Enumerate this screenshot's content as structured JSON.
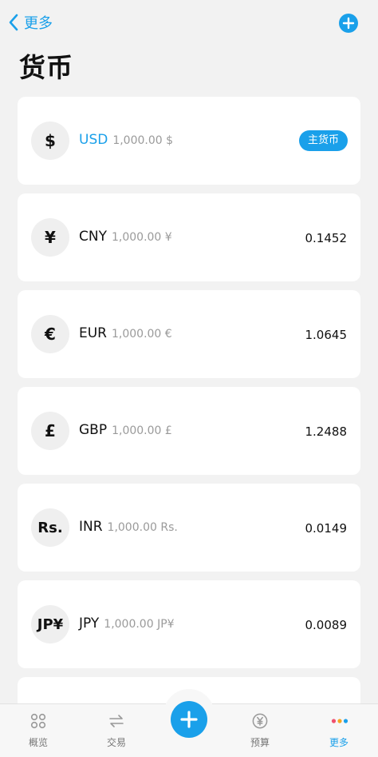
{
  "nav": {
    "back_label": "更多",
    "back_icon": "chevron-left-icon",
    "add_icon": "plus-circle-icon"
  },
  "page": {
    "title": "货币"
  },
  "currencies": [
    {
      "symbol": "$",
      "code": "USD",
      "amount": "1,000.00 $",
      "badge": "主货币",
      "rate": ""
    },
    {
      "symbol": "¥",
      "code": "CNY",
      "amount": "1,000.00 ¥",
      "badge": "",
      "rate": "0.1452"
    },
    {
      "symbol": "€",
      "code": "EUR",
      "amount": "1,000.00 €",
      "badge": "",
      "rate": "1.0645"
    },
    {
      "symbol": "£",
      "code": "GBP",
      "amount": "1,000.00 £",
      "badge": "",
      "rate": "1.2488"
    },
    {
      "symbol": "Rs.",
      "code": "INR",
      "amount": "1,000.00 Rs.",
      "badge": "",
      "rate": "0.0149"
    },
    {
      "symbol": "JP¥",
      "code": "JPY",
      "amount": "1,000.00 JP¥",
      "badge": "",
      "rate": "0.0089"
    }
  ],
  "tabbar": {
    "items": [
      {
        "label": "概览",
        "icon": "overview-grid-icon",
        "active": false
      },
      {
        "label": "交易",
        "icon": "transfer-arrows-icon",
        "active": false
      },
      {
        "label": "预算",
        "icon": "yen-circle-icon",
        "active": false
      },
      {
        "label": "更多",
        "icon": "more-dots-icon",
        "active": true
      }
    ],
    "fab_icon": "plus-icon"
  },
  "colors": {
    "accent": "#1aa0ea",
    "background": "#f2f2f2",
    "card": "#ffffff",
    "muted_text": "#9a9a9a"
  }
}
